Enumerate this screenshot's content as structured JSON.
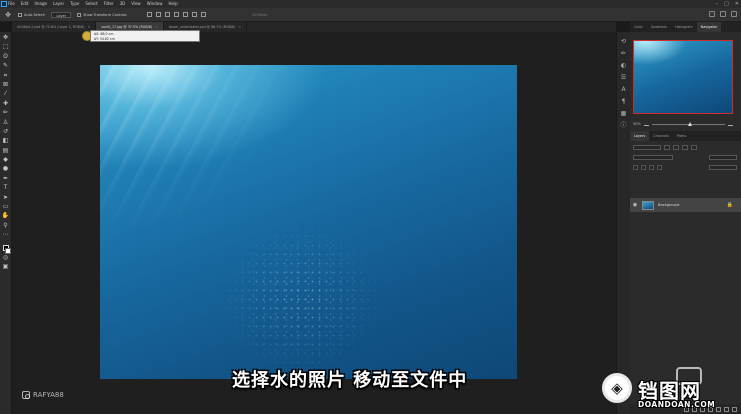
{
  "menubar": {
    "items": [
      "File",
      "Edit",
      "Image",
      "Layer",
      "Type",
      "Select",
      "Filter",
      "3D",
      "View",
      "Window",
      "Help"
    ],
    "window_controls": [
      "–",
      "□",
      "✕"
    ]
  },
  "options_bar": {
    "auto_select_label": "Auto-Select:",
    "auto_select_value": "Layer",
    "show_transform_label": "Show Transform Controls",
    "mode_3d_label": "3D Mode:"
  },
  "doc_tabs": [
    {
      "label": "Untitled-2.psd @ 72.6% (Layer 1, RGB/8)",
      "active": false
    },
    {
      "label": "sunlit_17.jpg @ 37.5% (RGB/8)",
      "active": true
    },
    {
      "label": "beam_underwater.psd @ 66.7% (RGB/8)",
      "active": false
    }
  ],
  "drag_tooltip": {
    "line1": "ΔX: 88.0 cm",
    "line2": "ΔY: 34.62 cm"
  },
  "right_panel": {
    "top_tabs": [
      "Color",
      "Swatches",
      "Histogram",
      "Navigator"
    ],
    "active_top_tab": "Navigator",
    "zoom_value": "50%",
    "layers_tabs": [
      "Layers",
      "Channels",
      "Paths"
    ],
    "active_layers_tab": "Layers",
    "layer_name": "Background"
  },
  "subtitle": "选择水的照片 移动至文件中",
  "watermark_handle": "RAFYA88",
  "site_logo": {
    "name_cn": "铛图网",
    "domain": "DOANDOAN.COM"
  },
  "colors": {
    "accent": "#31a8ff",
    "water_dark": "#0e4778",
    "water_light": "#2f9cc9"
  }
}
